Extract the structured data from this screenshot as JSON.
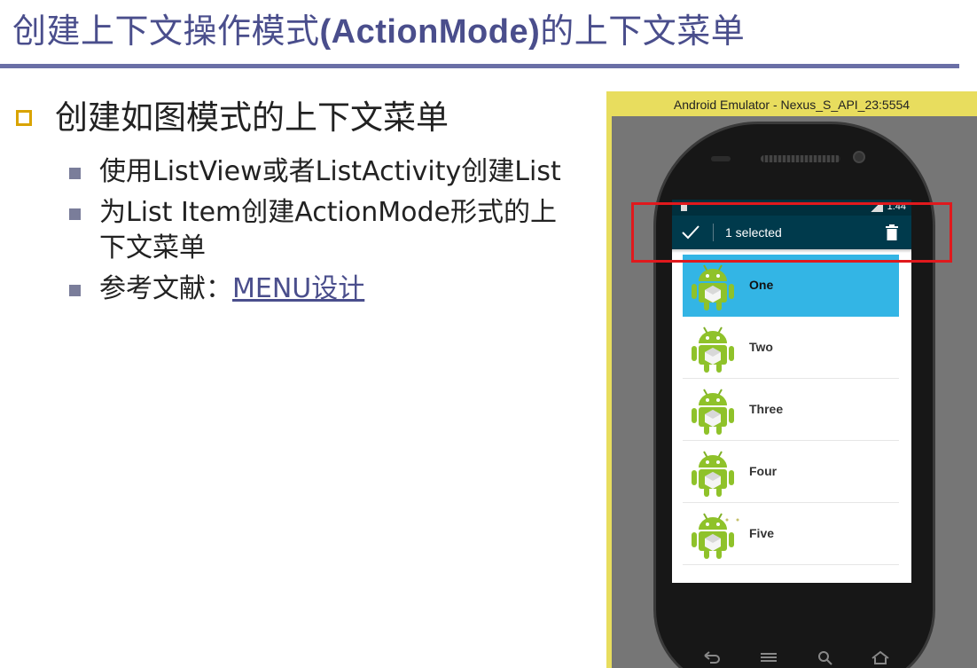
{
  "slide": {
    "title_part1": "创建上下文操作模式",
    "title_bold": "(ActionMode)",
    "title_part2": "的上下文菜单",
    "accent": "#4a4e8c"
  },
  "bullets": {
    "main": "创建如图模式的上下文菜单",
    "sub": [
      "使用ListView或者ListActivity创建List",
      "为List Item创建ActionMode形式的上下文菜单"
    ],
    "ref_prefix": "参考文献：",
    "ref_link": "MENU设计"
  },
  "emulator": {
    "window_title": "Android Emulator - Nexus_S_API_23:5554",
    "status_time": "1:44",
    "action_mode": {
      "title": "1 selected",
      "done_icon": "check-icon",
      "delete_icon": "trash-icon",
      "bar_color": "#003a4c"
    },
    "list": {
      "selected_color": "#33b5e5",
      "items": [
        {
          "label": "One",
          "selected": true
        },
        {
          "label": "Two",
          "selected": false
        },
        {
          "label": "Three",
          "selected": false
        },
        {
          "label": "Four",
          "selected": false
        },
        {
          "label": "Five",
          "selected": false
        }
      ]
    },
    "nav_icons": [
      "back-icon",
      "menu-icon",
      "search-icon",
      "home-icon"
    ]
  },
  "highlight_color": "#e0191d"
}
